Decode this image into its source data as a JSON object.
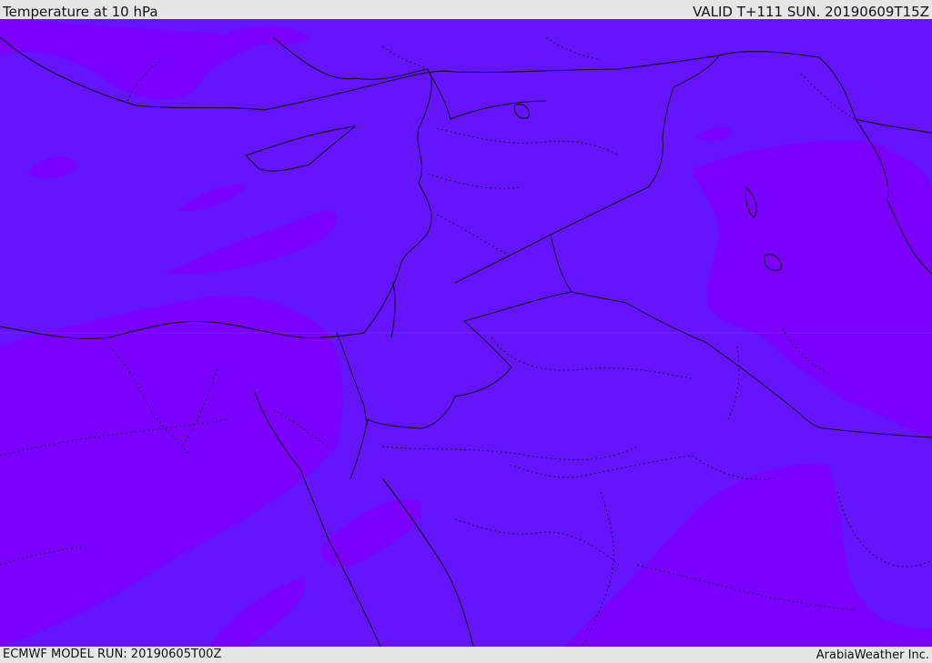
{
  "header": {
    "title": "Temperature at 10 hPa",
    "valid_time": "VALID T+111 SUN. 20190609T15Z"
  },
  "footer": {
    "model_run": "ECMWF MODEL RUN: 20190605T00Z",
    "credit": "ArabiaWeather Inc."
  },
  "map": {
    "fill_colors": {
      "base": "#6414ff",
      "warm_band": "#7a00ff"
    },
    "region": "Eastern Mediterranean / Middle East"
  }
}
